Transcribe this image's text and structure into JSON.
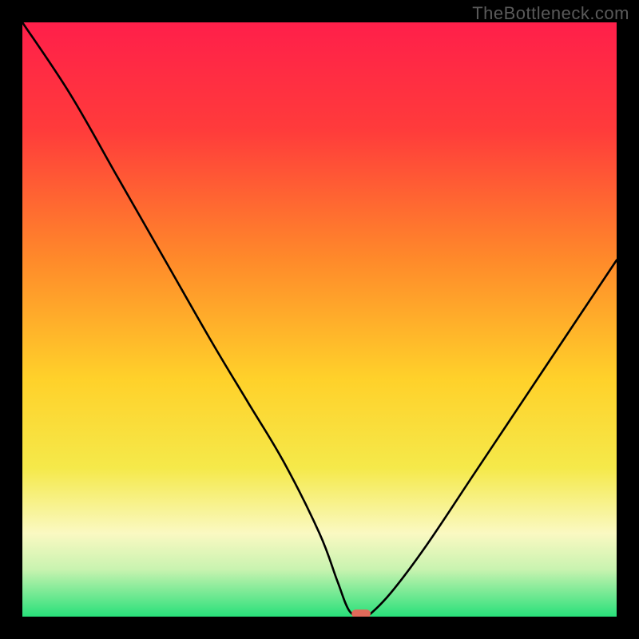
{
  "watermark": "TheBottleneck.com",
  "chart_data": {
    "type": "line",
    "title": "",
    "xlabel": "",
    "ylabel": "",
    "xlim": [
      0,
      100
    ],
    "ylim": [
      0,
      100
    ],
    "grid": false,
    "legend": false,
    "background_gradient": {
      "stops_y_percent_from_top_to_color": [
        [
          0,
          "#ff1f4a"
        ],
        [
          18,
          "#ff3b3b"
        ],
        [
          40,
          "#ff8a2a"
        ],
        [
          60,
          "#ffd12a"
        ],
        [
          75,
          "#f5e94a"
        ],
        [
          86,
          "#faf9c2"
        ],
        [
          92,
          "#c9f3b0"
        ],
        [
          100,
          "#28e07a"
        ]
      ]
    },
    "series": [
      {
        "name": "bottleneck-curve",
        "x": [
          0,
          8,
          16,
          24,
          32,
          38,
          44,
          50,
          53,
          55,
          57,
          58,
          62,
          68,
          76,
          84,
          92,
          100
        ],
        "y": [
          100,
          88,
          74,
          60,
          46,
          36,
          26,
          14,
          6,
          1,
          0,
          0,
          4,
          12,
          24,
          36,
          48,
          60
        ]
      }
    ],
    "marker": {
      "name": "optimal-point",
      "x": 57,
      "y": 0.5,
      "shape": "pill",
      "width_pct": 3.2,
      "height_pct": 1.4,
      "color": "#e06a5a"
    }
  }
}
